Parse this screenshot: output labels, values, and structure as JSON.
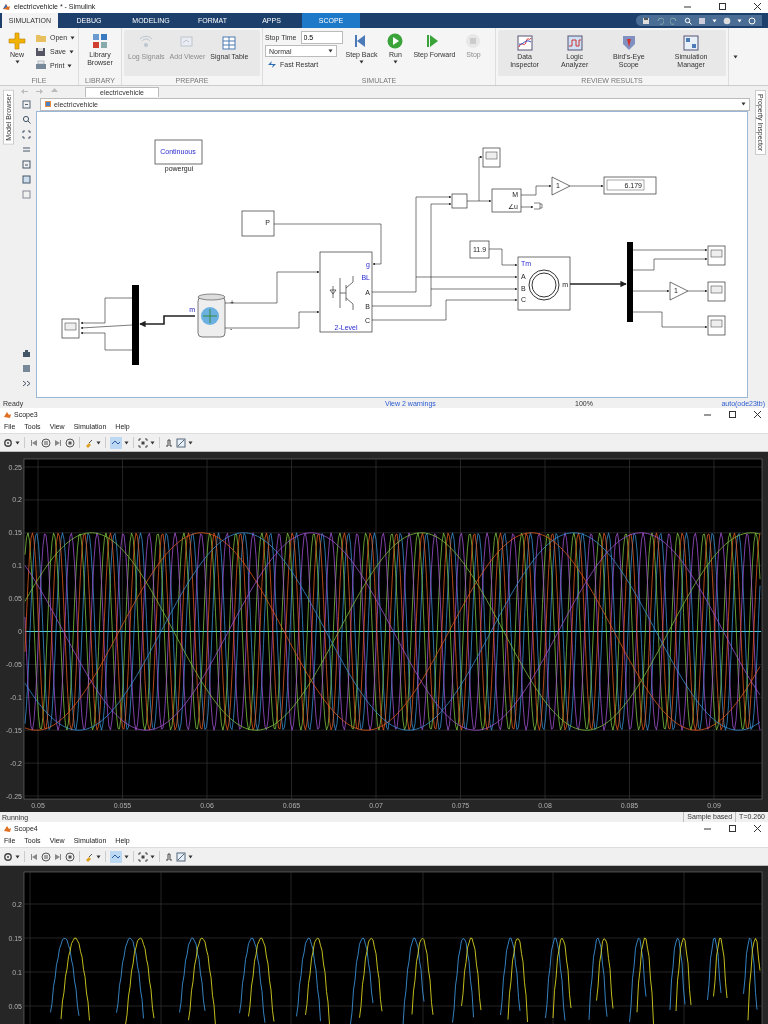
{
  "window": {
    "title": "electricvehicle * - Simulink"
  },
  "tabs": [
    {
      "label": "SIMULATION",
      "selected": true,
      "contextual": false
    },
    {
      "label": "DEBUG",
      "selected": false,
      "contextual": false
    },
    {
      "label": "MODELING",
      "selected": false,
      "contextual": false
    },
    {
      "label": "FORMAT",
      "selected": false,
      "contextual": false
    },
    {
      "label": "APPS",
      "selected": false,
      "contextual": false
    },
    {
      "label": "SCOPE",
      "selected": false,
      "contextual": true
    }
  ],
  "ribbon": {
    "groups": [
      {
        "title": "FILE",
        "items": [
          {
            "kind": "large",
            "label": "New",
            "disabled": false,
            "menu": true
          },
          {
            "kind": "small",
            "label": "Open",
            "disabled": false,
            "menu": true
          },
          {
            "kind": "small",
            "label": "Save",
            "disabled": false,
            "menu": true
          },
          {
            "kind": "small",
            "label": "Print",
            "disabled": false,
            "menu": true
          }
        ]
      },
      {
        "title": "LIBRARY",
        "items": [
          {
            "kind": "large",
            "label": "Library Browser",
            "disabled": false,
            "menu": false
          }
        ]
      },
      {
        "title": "PREPARE",
        "items": [
          {
            "kind": "large",
            "label": "Log Signals",
            "disabled": true,
            "menu": false
          },
          {
            "kind": "large",
            "label": "Add Viewer",
            "disabled": true,
            "menu": false
          },
          {
            "kind": "large",
            "label": "Signal Table",
            "disabled": false,
            "menu": false
          }
        ]
      },
      {
        "title": "SIMULATE",
        "items": [
          {
            "kind": "field",
            "label": "Stop Time",
            "value": "0.5"
          },
          {
            "kind": "dropdown",
            "value": "Normal"
          },
          {
            "kind": "toggle",
            "label": "Fast Restart"
          },
          {
            "kind": "large",
            "label": "Step Back",
            "disabled": false,
            "menu": true
          },
          {
            "kind": "large",
            "label": "Run",
            "disabled": false,
            "menu": true
          },
          {
            "kind": "large",
            "label": "Step Forward",
            "disabled": false,
            "menu": false
          },
          {
            "kind": "large",
            "label": "Stop",
            "disabled": true,
            "menu": false
          }
        ]
      },
      {
        "title": "REVIEW RESULTS",
        "items": [
          {
            "kind": "large",
            "label": "Data Inspector",
            "disabled": false,
            "menu": false
          },
          {
            "kind": "large",
            "label": "Logic Analyzer",
            "disabled": false,
            "menu": false
          },
          {
            "kind": "large",
            "label": "Bird's-Eye Scope",
            "disabled": false,
            "menu": false
          },
          {
            "kind": "large",
            "label": "Simulation Manager",
            "disabled": false,
            "menu": false
          }
        ]
      }
    ]
  },
  "editor": {
    "side_left": "Model Browser",
    "side_right": "Property Inspector",
    "tab": "electricvehicle",
    "breadcrumb": "electricvehicle",
    "diagram": {
      "powergui": {
        "text": "Continuous",
        "label": "powergui"
      },
      "pulse_block": {
        "port": "P"
      },
      "inverter": {
        "ports": [
          "g",
          "BL",
          "A",
          "B",
          "C"
        ],
        "label": "2-Level"
      },
      "battery": {
        "ports": [
          "+",
          "-",
          "m"
        ]
      },
      "torque": {
        "value": "11.9"
      },
      "motor": {
        "ports": [
          "Tm",
          "A",
          "B",
          "C",
          "m"
        ]
      },
      "polar": {
        "ports": [
          "M",
          "∠u"
        ]
      },
      "gains": [
        "1",
        "1"
      ],
      "display": {
        "value": "6.179"
      }
    }
  },
  "status_bar": {
    "state": "Ready",
    "warnings": "View 2 warnings",
    "zoom": "100%",
    "solver": "auto(ode23tb)"
  },
  "scopes": [
    {
      "title": "Scope3",
      "menu": [
        "File",
        "Tools",
        "View",
        "Simulation",
        "Help"
      ],
      "y_ticks": [
        "0.25",
        "0.2",
        "0.15",
        "0.1",
        "0.05",
        "0",
        "-0.05",
        "-0.1",
        "-0.15",
        "-0.2",
        "-0.25"
      ],
      "x_ticks": [
        "0.05",
        "0.055",
        "0.06",
        "0.065",
        "0.07",
        "0.075",
        "0.08",
        "0.085",
        "0.09"
      ],
      "status": "Running",
      "mode": "Sample based",
      "time": "T=0.260"
    },
    {
      "title": "Scope4",
      "menu": [
        "File",
        "Tools",
        "View",
        "Simulation",
        "Help"
      ],
      "y_ticks": [
        "0.2",
        "0.15",
        "0.1",
        "0.05"
      ]
    }
  ]
}
